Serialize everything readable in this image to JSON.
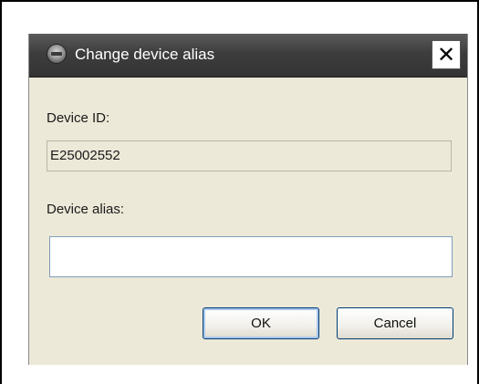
{
  "dialog": {
    "title": "Change device alias",
    "close_glyph": "✕",
    "icon": "app-icon"
  },
  "form": {
    "device_id_label": "Device ID:",
    "device_id_value": "E25002552",
    "device_alias_label": "Device alias:",
    "device_alias_value": "",
    "device_alias_placeholder": ""
  },
  "buttons": {
    "ok_label": "OK",
    "cancel_label": "Cancel"
  },
  "colors": {
    "dialog_bg": "#ece9d8",
    "titlebar": "#3d3d3d",
    "button_border": "#003c74"
  }
}
